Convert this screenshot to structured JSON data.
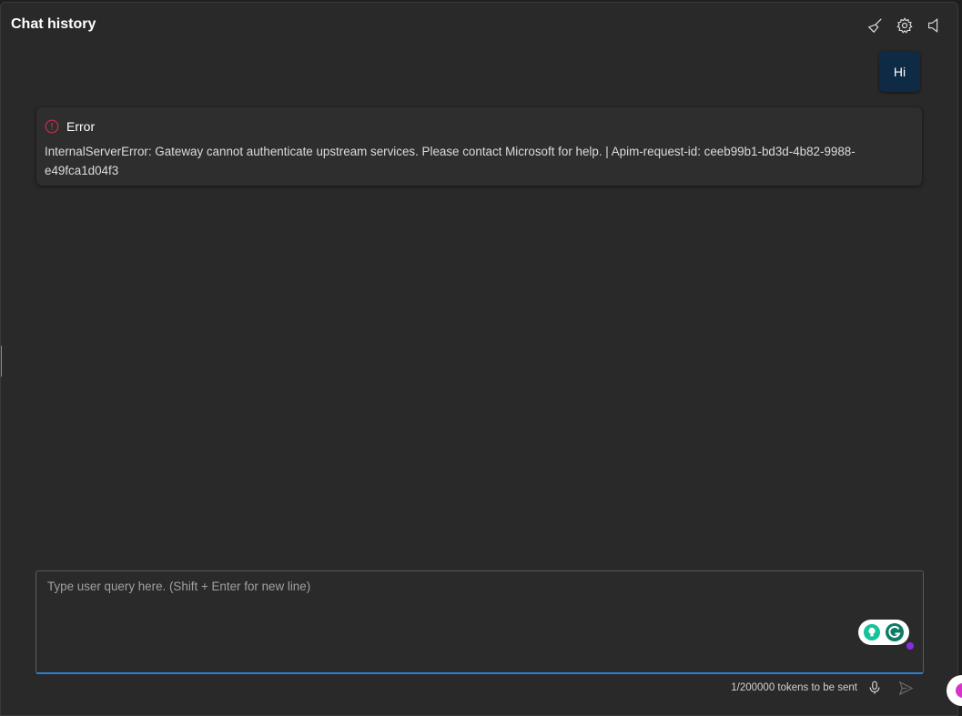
{
  "header": {
    "title": "Chat history",
    "icons": [
      "broom-icon",
      "gear-icon",
      "speaker-icon"
    ]
  },
  "messages": [
    {
      "role": "user",
      "text": "Hi"
    },
    {
      "role": "error",
      "title": "Error",
      "text": "InternalServerError: Gateway cannot authenticate upstream services. Please contact Microsoft for help. | Apim-request-id: ceeb99b1-bd3d-4b82-9988-e49fca1d04f3"
    }
  ],
  "composer": {
    "placeholder": "Type user query here. (Shift + Enter for new line)",
    "value": "",
    "token_status": "1/200000 tokens to be sent"
  },
  "colors": {
    "accent": "#2f7fd1",
    "error": "#c4314b",
    "user_bubble": "#0f2a45",
    "grammarly": "#15c39a"
  }
}
